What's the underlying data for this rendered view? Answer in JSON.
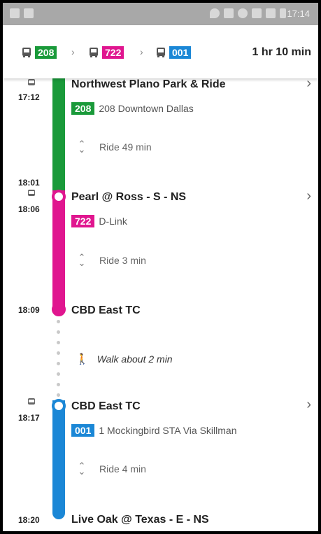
{
  "colors": {
    "green": "#1a9a3a",
    "magenta": "#e0168f",
    "blue": "#1b87d6"
  },
  "status_bar": {
    "time": "17:14"
  },
  "summary": {
    "legs": [
      {
        "route": "208",
        "color": "#1a9a3a"
      },
      {
        "route": "722",
        "color": "#e0168f"
      },
      {
        "route": "001",
        "color": "#1b87d6"
      }
    ],
    "total_duration": "1 hr 10 min"
  },
  "stops": [
    {
      "time_depart": "17:12",
      "name": "Northwest Plano Park & Ride",
      "route": "208",
      "route_desc": "208 Downtown Dallas",
      "ride": "Ride 49 min"
    },
    {
      "time_arrive": "18:01",
      "time_depart": "18:06",
      "name": "Pearl @ Ross - S - NS",
      "route": "722",
      "route_desc": "D-Link",
      "ride": "Ride 3 min"
    },
    {
      "time_arrive": "18:09",
      "name": "CBD East TC",
      "walk": "Walk about 2 min"
    },
    {
      "time_depart": "18:17",
      "name": "CBD East TC",
      "route": "001",
      "route_desc": "1 Mockingbird STA Via Skillman",
      "ride": "Ride 4 min"
    },
    {
      "time_arrive": "18:20",
      "name": "Live Oak @ Texas - E - NS"
    }
  ]
}
